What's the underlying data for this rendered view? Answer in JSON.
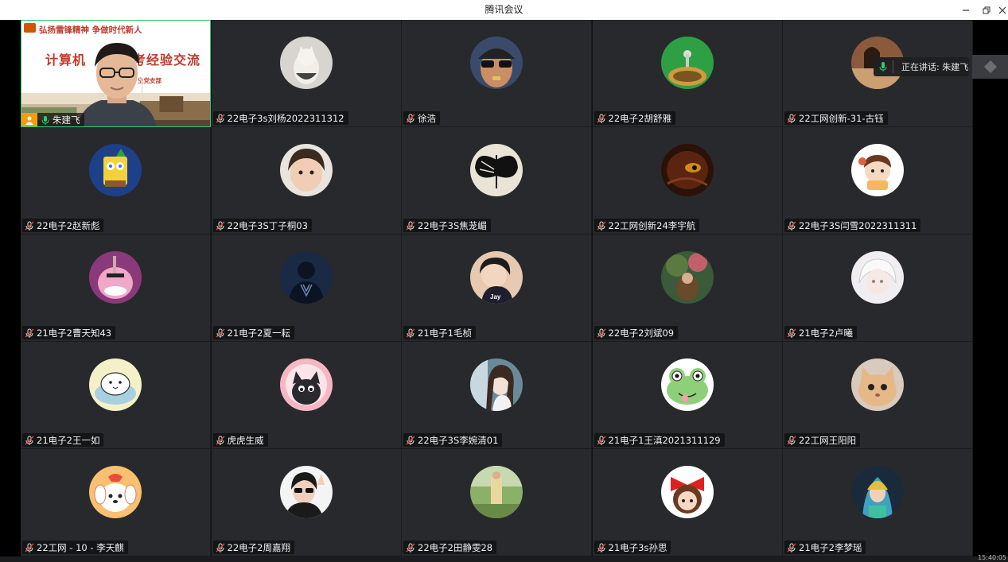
{
  "window": {
    "title": "腾讯会议"
  },
  "speaking": {
    "label": "正在讲话: 朱建飞"
  },
  "presenter": {
    "name": "朱建飞",
    "slide_top": "弘扬雷锋精神 争做时代新人",
    "slide_title_left": "计算机",
    "slide_title_right": "考经验交流",
    "slide_sub": "生党支部"
  },
  "participants": [
    {
      "name": "22电子3s刘杨2022311312",
      "icon": "cat-avatar-icon"
    },
    {
      "name": "徐浩",
      "icon": "sunglasses-person-avatar-icon"
    },
    {
      "name": "22电子2胡舒雅",
      "icon": "game-mushroom-avatar-icon"
    },
    {
      "name": "22工网创新-31-古钰",
      "icon": "girl-photo-avatar-icon"
    },
    {
      "name": "22电子2赵新彪",
      "icon": "spongebob-avatar-icon"
    },
    {
      "name": "22电子3S丁子桐03",
      "icon": "child-avatar-icon"
    },
    {
      "name": "22电子3S焦茏嵋",
      "icon": "butterfly-avatar-icon"
    },
    {
      "name": "22工网创新24李宇航",
      "icon": "dark-creature-avatar-icon"
    },
    {
      "name": "22电子3S闫雪2022311311",
      "icon": "cartoon-girl-avatar-icon"
    },
    {
      "name": "21电子2曹天知43",
      "icon": "purple-cartoon-avatar-icon"
    },
    {
      "name": "21电子2夏一耘",
      "icon": "silhouette-avatar-icon"
    },
    {
      "name": "21电子1毛桢",
      "icon": "jay-cartoon-avatar-icon"
    },
    {
      "name": "22电子2刘斌09",
      "icon": "forest-art-avatar-icon"
    },
    {
      "name": "21电子2卢曦",
      "icon": "anime-white-avatar-icon"
    },
    {
      "name": "21电子2王一如",
      "icon": "seal-cartoon-avatar-icon"
    },
    {
      "name": "虎虎生威",
      "icon": "black-cat-avatar-icon"
    },
    {
      "name": "22电子3S李婉清01",
      "icon": "anime-girl-avatar-icon"
    },
    {
      "name": "21电子1王滇2021311129",
      "icon": "frog-avatar-icon"
    },
    {
      "name": "22工网王阳阳",
      "icon": "cat-meme-avatar-icon"
    },
    {
      "name": "22工网 - 10 - 李天麒",
      "icon": "puppy-avatar-icon"
    },
    {
      "name": "22电子2周嘉翔",
      "icon": "sunglasses-girl-avatar-icon"
    },
    {
      "name": "22电子2田静雯28",
      "icon": "outdoor-photo-avatar-icon"
    },
    {
      "name": "21电子3s孙思",
      "icon": "red-bow-girl-avatar-icon"
    },
    {
      "name": "21电子2李梦瑶",
      "icon": "colorful-girl-avatar-icon"
    }
  ],
  "taskbar": {
    "clock": "15:40:05"
  },
  "colors": {
    "tile_bg": "#28292c",
    "grid_bg": "#111214",
    "active_border": "#2ecc71",
    "slide_red": "#c0392b"
  }
}
